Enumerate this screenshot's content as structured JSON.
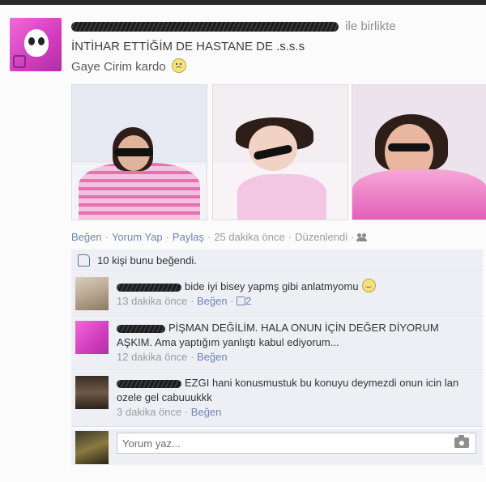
{
  "post": {
    "header_suffix": "ile birlikte",
    "title": "İNTİHAR ETTİĞİM DE HASTANE DE .s.s.s",
    "subtitle": "Gaye Cirim kardo",
    "actions": {
      "like": "Beğen",
      "comment": "Yorum Yap",
      "share": "Paylaş",
      "time": "25 dakika önce",
      "edited": "Düzenlendi"
    },
    "likes_text": "10 kişi bunu beğendi."
  },
  "comments": [
    {
      "text": "bide iyi bisey yapmş gibi anlatmyomu",
      "time": "13 dakika önce",
      "like": "Beğen",
      "like_count": "2"
    },
    {
      "text": "PİŞMAN DEĞİLİM. HALA ONUN İÇİN DEĞER DİYORUM AŞKIM. Ama yaptığım yanlıştı kabul ediyorum...",
      "time": "12 dakika önce",
      "like": "Beğen"
    },
    {
      "text": "EZGI hani konusmustuk bu konuyu deymezdi onun icin lan ozele gel cabuuukkk",
      "time": "3 dakika önce",
      "like": "Beğen"
    }
  ],
  "composer": {
    "placeholder": "Yorum yaz..."
  },
  "icons": [
    "sad-face-icon",
    "people-icon",
    "thumbs-up-icon",
    "smile-icon",
    "camera-icon"
  ]
}
